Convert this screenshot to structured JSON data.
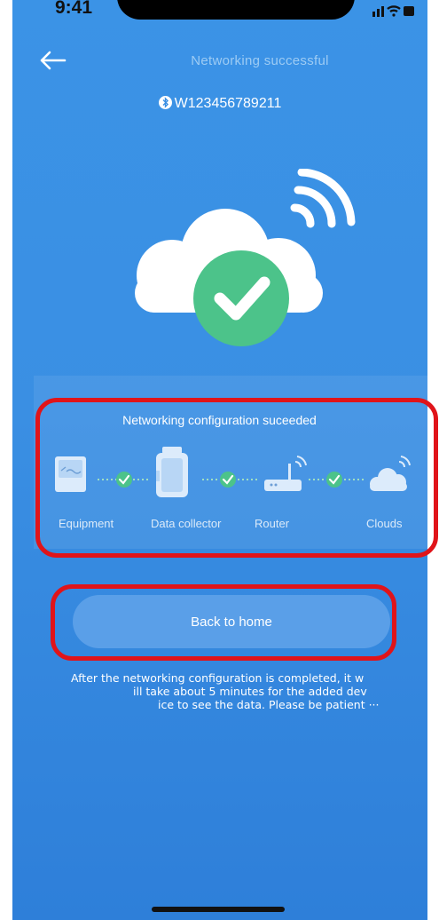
{
  "status_bar": {
    "time": "9:41"
  },
  "header": {
    "title": "Networking successful",
    "device_id": "W123456789211"
  },
  "icons": {
    "back": "back-arrow-icon",
    "bluetooth": "bluetooth-icon",
    "cloud": "cloud-icon",
    "check": "check-icon",
    "wifi": "wifi-icon"
  },
  "config": {
    "title": "Networking configuration suceeded",
    "steps": [
      {
        "label": "Equipment",
        "icon": "inverter-icon"
      },
      {
        "label": "Data collector",
        "icon": "data-collector-icon"
      },
      {
        "label": "Router",
        "icon": "router-icon"
      },
      {
        "label": "Clouds",
        "icon": "cloud-icon"
      }
    ]
  },
  "actions": {
    "home_label": "Back to home"
  },
  "note": {
    "line1": "After the networking configuration is completed, it w",
    "line2": "ill take about 5 minutes for the added dev",
    "line3": "ice to see the data. Please be patient ···"
  },
  "colors": {
    "background": "#3a8fe3",
    "check_green": "#4cc38a",
    "highlight": "#e0141a"
  }
}
